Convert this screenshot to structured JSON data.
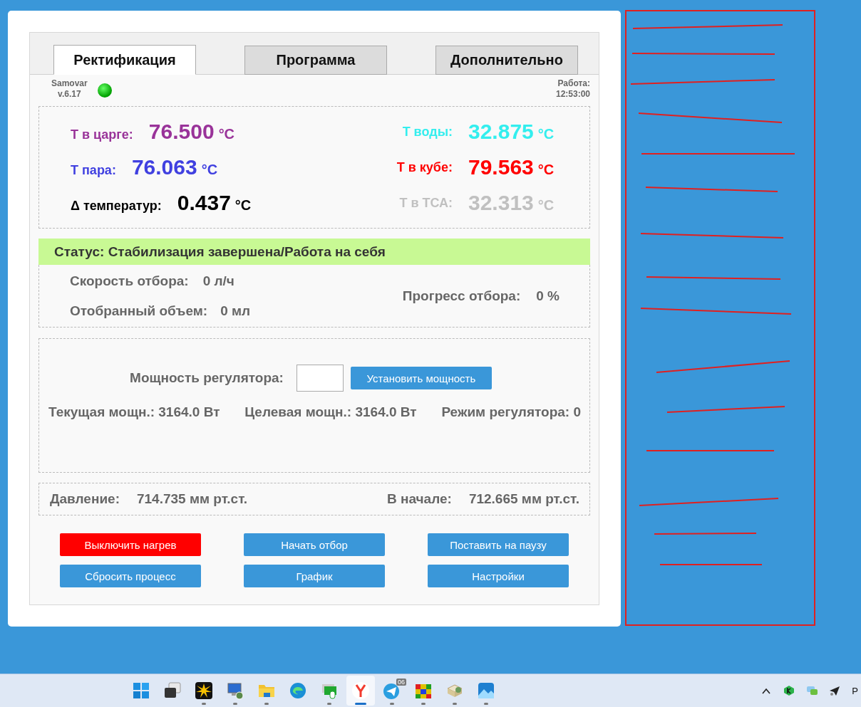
{
  "tabs": [
    {
      "label": "Ректификация",
      "selected": true
    },
    {
      "label": "Программа",
      "selected": false
    },
    {
      "label": "Дополнительно",
      "selected": false
    }
  ],
  "header": {
    "app_name": "Samovar",
    "version": "v.6.17",
    "connected": true,
    "uptime_label": "Работа:",
    "uptime": "12:53:00"
  },
  "temperatures": [
    {
      "label": "Т в царге:",
      "value": "76.500",
      "unit": "°C",
      "color": "#993399"
    },
    {
      "label": "Т воды:",
      "value": "32.875",
      "unit": "°C",
      "color": "#33eeee"
    },
    {
      "label": "Т пара:",
      "value": "76.063",
      "unit": "°C",
      "color": "#4040e0"
    },
    {
      "label": "Т в кубе:",
      "value": "79.563",
      "unit": "°C",
      "color": "#ff0000"
    },
    {
      "label": "Δ температур:",
      "value": "0.437",
      "unit": "°C",
      "color": "#000000"
    },
    {
      "label": "Т в ТСА:",
      "value": "32.313",
      "unit": "°C",
      "color": "#c0c0c0"
    }
  ],
  "status": "Статус: Стабилизация завершена/Работа на себя",
  "collection": {
    "speed_label": "Скорость отбора:",
    "speed": "0 л/ч",
    "volume_label": "Отобранный объем:",
    "volume": "0 мл",
    "progress_label": "Прогресс отбора:",
    "progress": "0 %"
  },
  "power": {
    "label": "Мощность регулятора:",
    "button": "Установить мощность",
    "current": "Текущая мощн.: 3164.0 Вт",
    "target": "Целевая мощн.: 3164.0 Вт",
    "mode": "Режим регулятора: 0"
  },
  "pressure": {
    "label": "Давление:",
    "value": "714.735 мм рт.ст.",
    "start_label": "В начале:",
    "start_value": "712.665 мм рт.ст."
  },
  "buttons": [
    {
      "label": "Выключить нагрев",
      "kind": "danger"
    },
    {
      "label": "Начать отбор",
      "kind": "normal"
    },
    {
      "label": "Поставить на паузу",
      "kind": "normal"
    },
    {
      "label": "Сбросить процесс",
      "kind": "normal"
    },
    {
      "label": "График",
      "kind": "normal"
    },
    {
      "label": "Настройки",
      "kind": "normal"
    }
  ],
  "taskbar": {
    "apps": [
      {
        "kind": "start",
        "selected": false,
        "running": false
      },
      {
        "kind": "taskview",
        "selected": false,
        "running": false
      },
      {
        "kind": "star",
        "selected": false,
        "running": true
      },
      {
        "kind": "remote",
        "selected": false,
        "running": true
      },
      {
        "kind": "folder",
        "selected": false,
        "running": true
      },
      {
        "kind": "browser",
        "selected": false,
        "running": false
      },
      {
        "kind": "monitor",
        "selected": false,
        "running": true
      },
      {
        "kind": "yandex",
        "selected": true,
        "running": true
      },
      {
        "kind": "telegram",
        "selected": false,
        "running": true,
        "badge": "06"
      },
      {
        "kind": "cube",
        "selected": false,
        "running": true
      },
      {
        "kind": "package",
        "selected": false,
        "running": true
      },
      {
        "kind": "photos",
        "selected": false,
        "running": true
      }
    ],
    "tray": [
      {
        "kind": "chevron"
      },
      {
        "kind": "shield"
      },
      {
        "kind": "chat"
      },
      {
        "kind": "send"
      }
    ],
    "language": "Р"
  }
}
